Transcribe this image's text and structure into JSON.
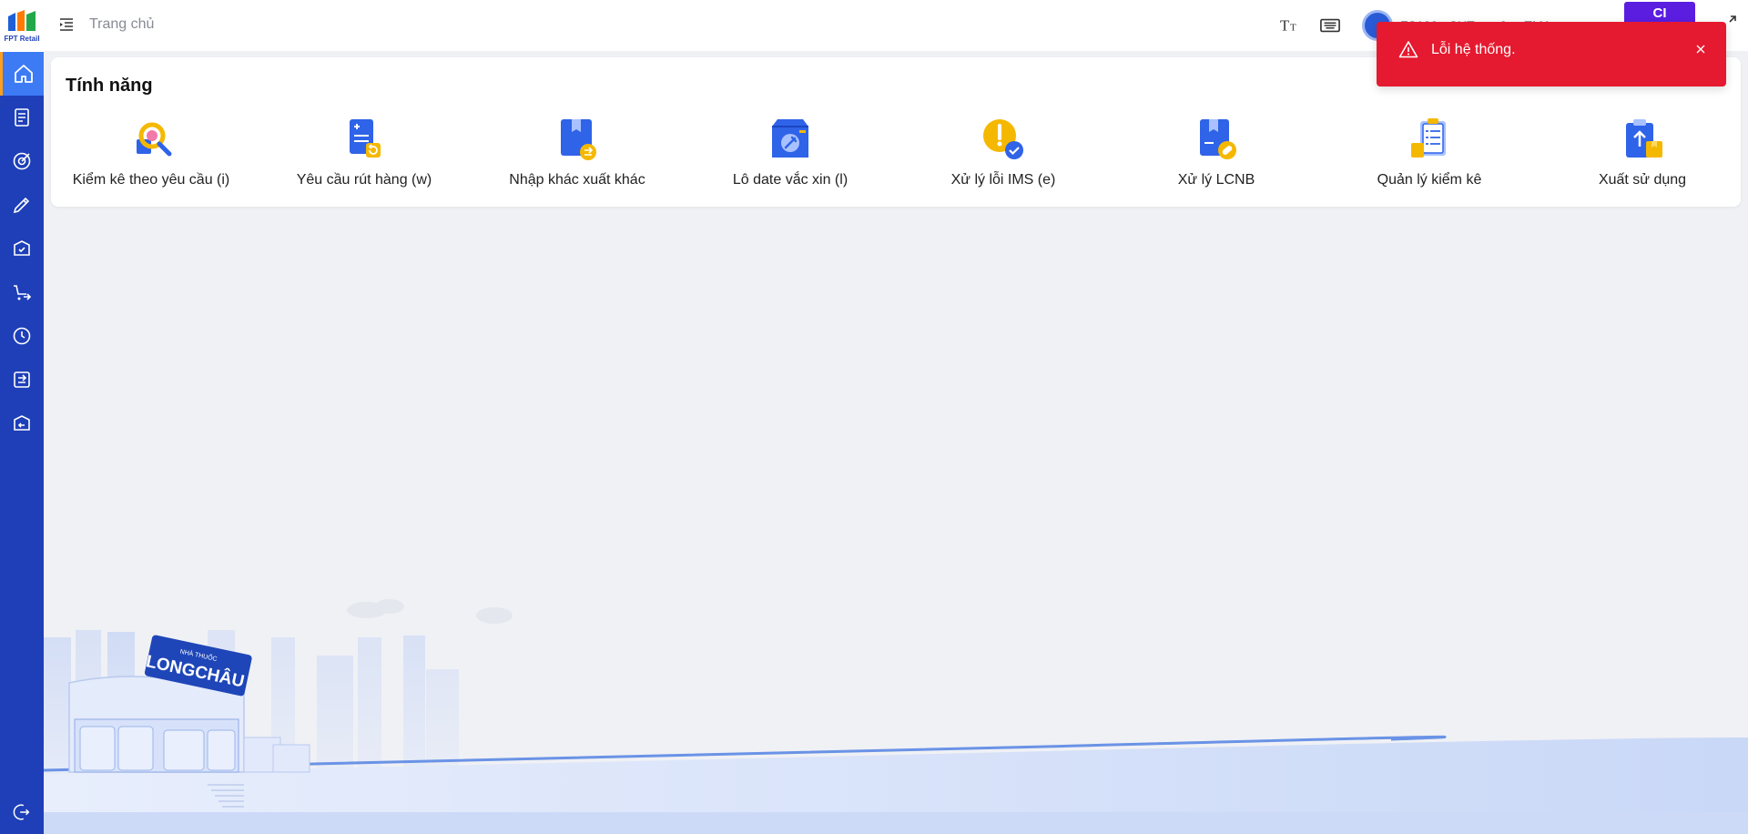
{
  "sidebar": {
    "logo_text": "FPT Retail",
    "items": [
      {
        "icon": "home-icon",
        "active": true
      },
      {
        "icon": "document-list-icon",
        "active": false
      },
      {
        "icon": "target-icon",
        "active": false
      },
      {
        "icon": "pen-tool-icon",
        "active": false
      },
      {
        "icon": "box-check-icon",
        "active": false
      },
      {
        "icon": "cart-transfer-icon",
        "active": false
      },
      {
        "icon": "clock-check-icon",
        "active": false
      },
      {
        "icon": "transfer-list-icon",
        "active": false
      },
      {
        "icon": "box-return-icon",
        "active": false
      }
    ],
    "bottom_icon": "logout-icon"
  },
  "header": {
    "breadcrumb": "Trang chủ",
    "store_text": "FS100 - SHT ... - 0 ... TMA...",
    "ci_label": "CI"
  },
  "features": {
    "title": "Tính năng",
    "items": [
      {
        "label": "Kiểm kê theo yêu cầu (i)",
        "icon": "inventory-search-icon"
      },
      {
        "label": "Yêu cầu rút hàng (w)",
        "icon": "withdraw-request-icon"
      },
      {
        "label": "Nhập khác xuất khác",
        "icon": "import-export-icon"
      },
      {
        "label": "Lô date vắc xin (l)",
        "icon": "vaccine-box-icon"
      },
      {
        "label": "Xử lý lỗi IMS (e)",
        "icon": "error-check-icon"
      },
      {
        "label": "Xử lý LCNB",
        "icon": "lcnb-pill-icon"
      },
      {
        "label": "Quản lý kiểm kê",
        "icon": "clipboard-checklist-icon"
      },
      {
        "label": "Xuất sử dụng",
        "icon": "export-usage-icon"
      }
    ]
  },
  "toast": {
    "message": "Lỗi hệ thống.",
    "color": "#e5192f"
  },
  "scene": {
    "store_sign_top": "NHÀ THUỐC",
    "store_sign": "LONGCHÂU"
  },
  "colors": {
    "sidebar": "#1e3fb8",
    "sidebar_active": "#3d7bf5",
    "accent": "#5b1de0"
  }
}
